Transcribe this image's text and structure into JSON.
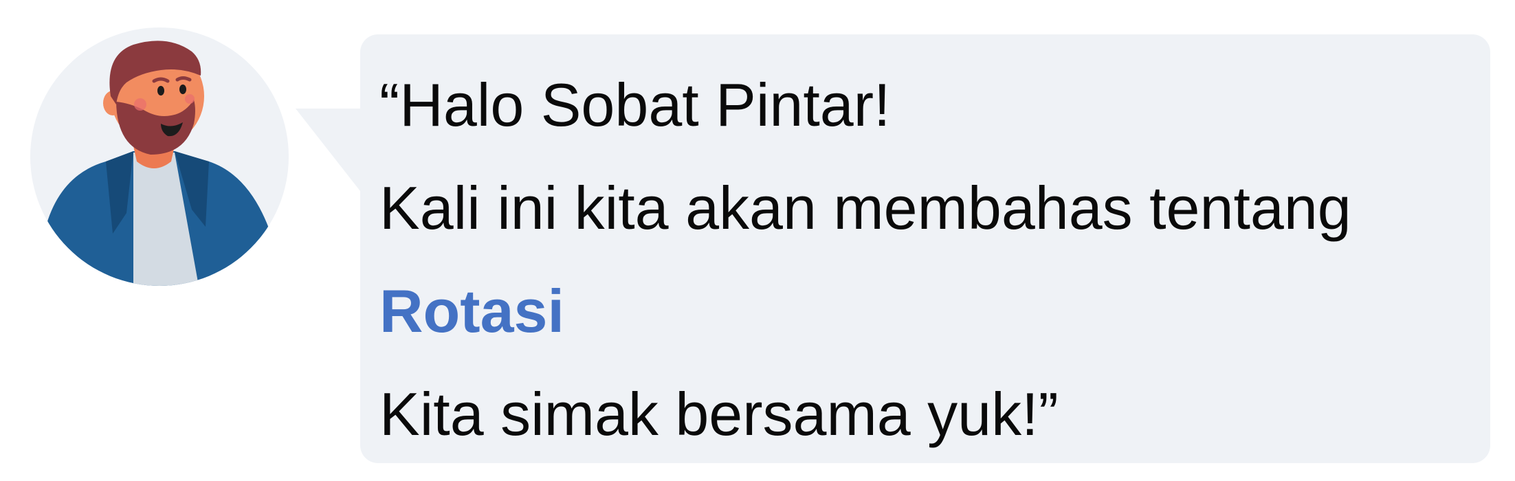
{
  "avatar": {
    "icon": "bearded-man-avatar-icon",
    "colors": {
      "circle_bg": "#eff2f6",
      "jacket": "#1f5f96",
      "jacket_dark": "#164a78",
      "shirt": "#d3dbe3",
      "skin": "#f28c60",
      "hair": "#8b3a3e"
    }
  },
  "bubble": {
    "background": "#eff2f6",
    "greeting": "“Halo Sobat Pintar!",
    "intro": "Kali ini kita akan membahas tentang",
    "topic": "Rotasi",
    "closing": "Kita simak bersama yuk!”",
    "topic_color": "#4472c4"
  }
}
